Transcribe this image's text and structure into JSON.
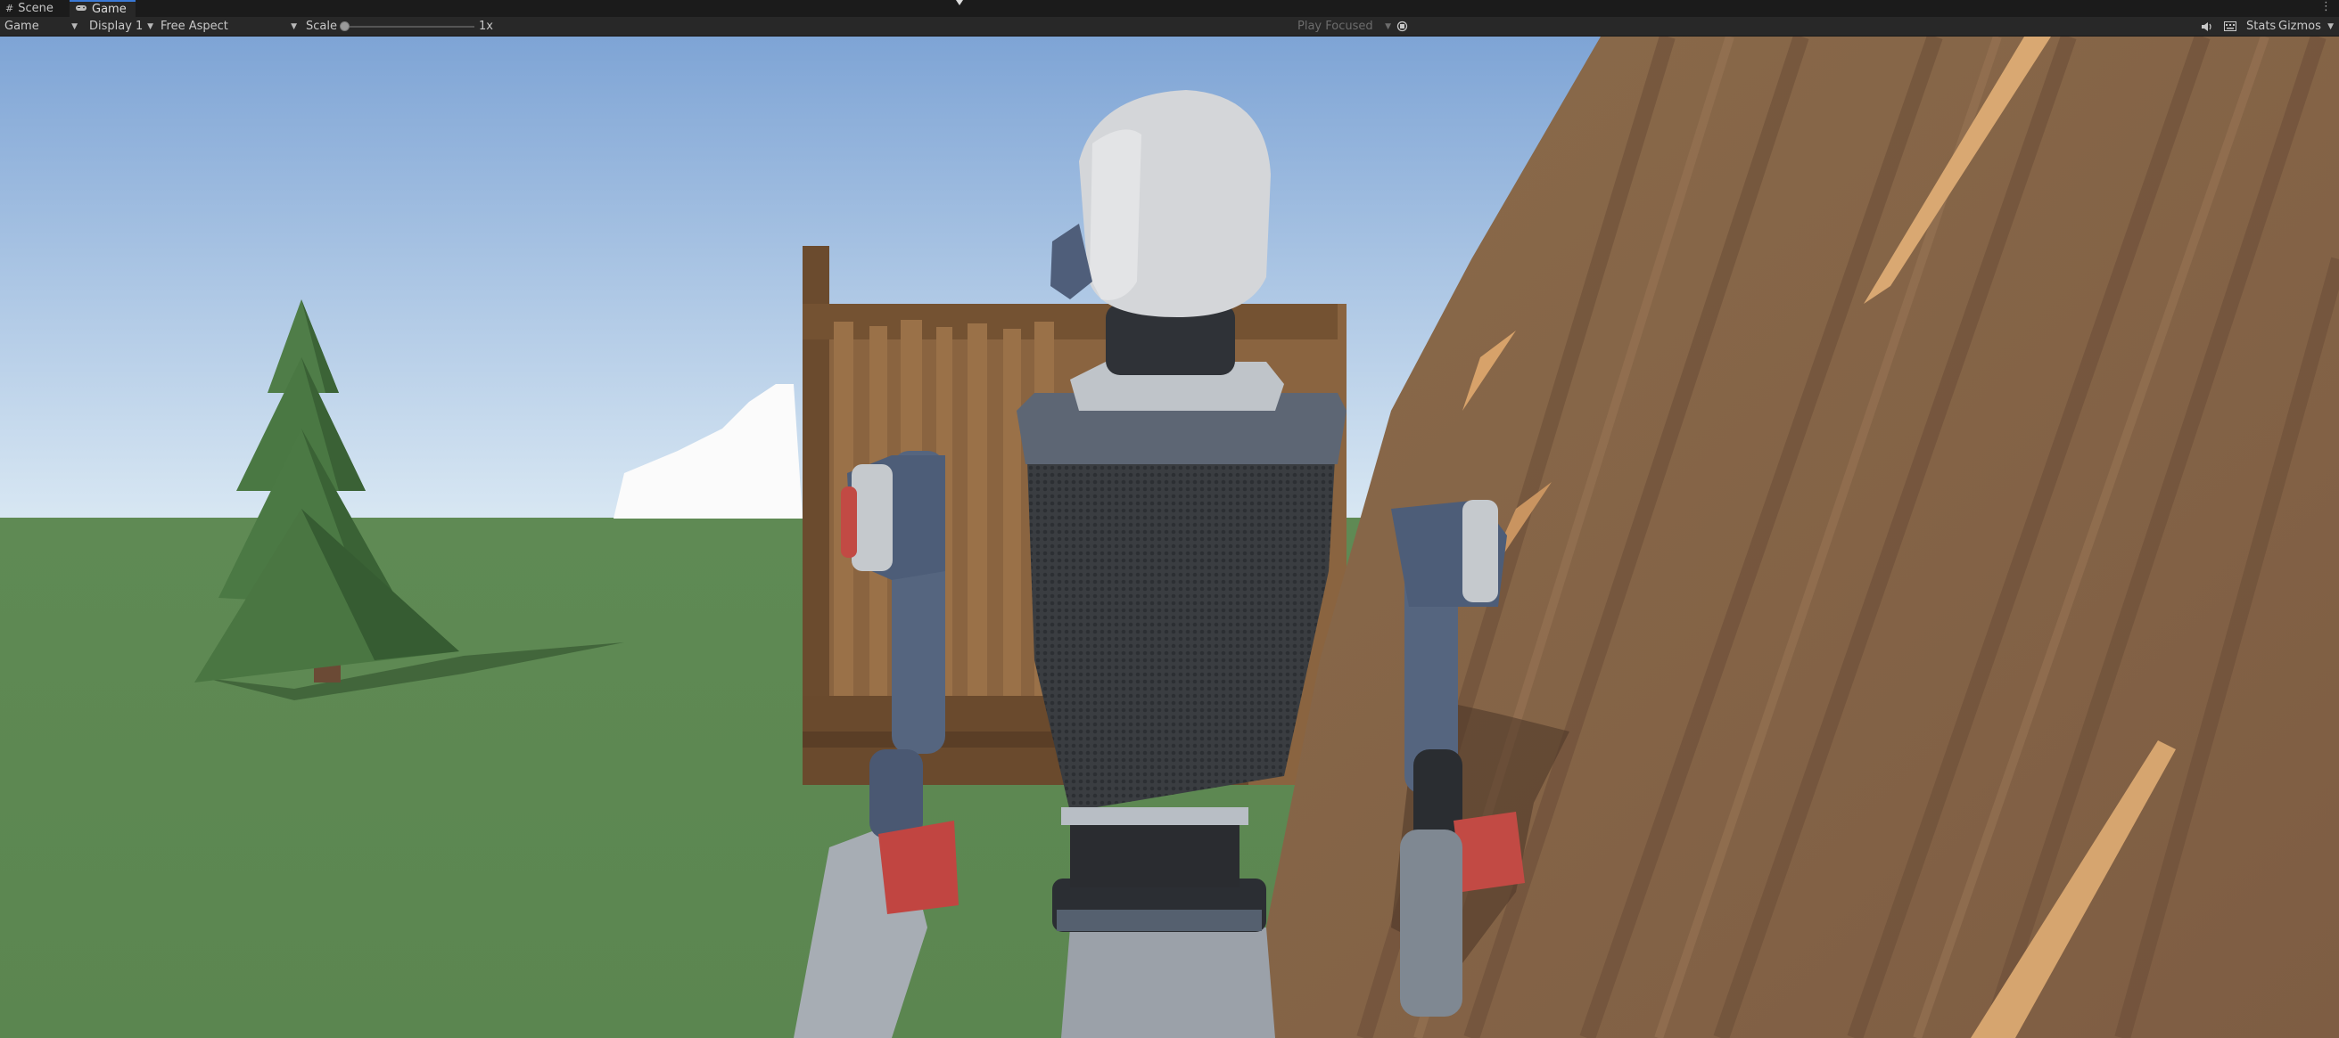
{
  "tabs": [
    {
      "label": "Scene",
      "icon": "hash-grid-icon",
      "active": false
    },
    {
      "label": "Game",
      "icon": "gamepad-icon",
      "active": true
    }
  ],
  "toolbar": {
    "view_select": "Game",
    "display_select": "Display 1",
    "aspect_select": "Free Aspect",
    "scale_label": "Scale",
    "scale_value": "1x",
    "play_mode": "Play Focused",
    "stats_label": "Stats",
    "gizmos_label": "Gizmos"
  },
  "icons": {
    "tab_menu": "more-vertical-icon",
    "vsync": "vsync-icon",
    "audio": "speaker-icon",
    "layout": "keyboard-icon"
  },
  "colors": {
    "accent": "#3a79d6",
    "panel": "#282828",
    "sky_top": "#7fa6d6",
    "ground": "#5f8a54",
    "roof": "#8a6548"
  }
}
